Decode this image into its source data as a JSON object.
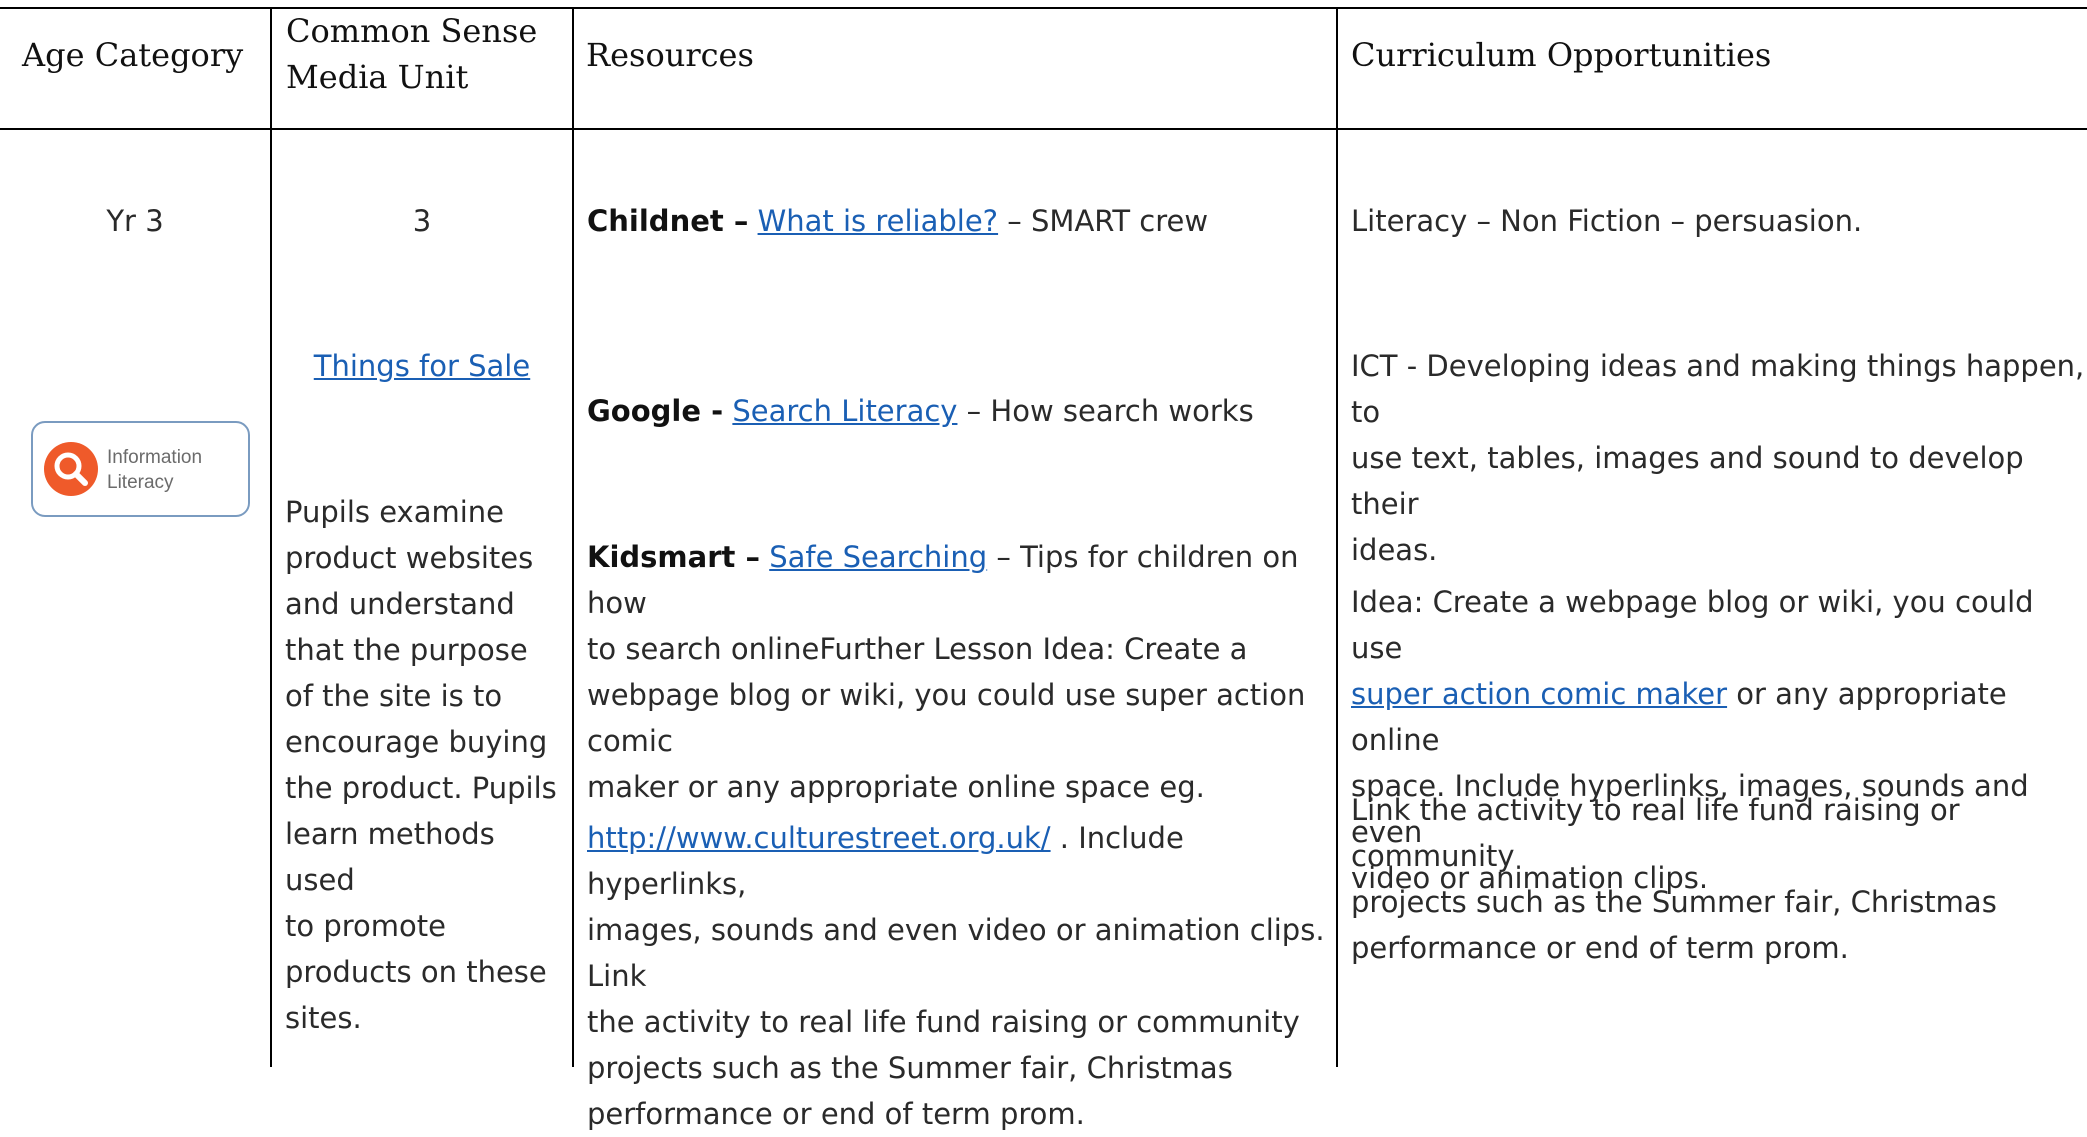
{
  "table": {
    "headers": {
      "age_category": "Age Category",
      "unit_line1": "Common Sense",
      "unit_line2": "Media Unit",
      "resources": "Resources",
      "curriculum": "Curriculum Opportunities"
    },
    "row": {
      "age": "Yr 3",
      "badge": {
        "line1": "Information",
        "line2": "Literacy",
        "icon": "magnifier-icon",
        "icon_color": "#ef5a2a"
      },
      "unit_number": "3",
      "unit_title": "Things for Sale",
      "unit_description": [
        "Pupils examine",
        "product websites",
        "and understand",
        "that the purpose",
        "of the site is to",
        "encourage buying",
        "the product. Pupils",
        "learn methods used",
        "to promote",
        "products on these",
        "sites."
      ],
      "resources": {
        "childnet": {
          "name": "Childnet –",
          "link": "What is reliable?",
          "rest": " – SMART crew"
        },
        "google": {
          "name": "Google -",
          "link": "Search Literacy",
          "rest": " – How search works"
        },
        "kidsmart": {
          "name": "Kidsmart –",
          "link": "Safe Searching",
          "rest_line1": " – Tips for children on how",
          "lines": [
            "to search onlineFurther Lesson Idea: Create a",
            "webpage blog or wiki, you could use super action comic",
            "maker  or any appropriate online space eg."
          ]
        },
        "culture_street": {
          "link": "http://www.culturestreet.org.uk/",
          "rest_line1": " . Include hyperlinks,",
          "lines": [
            "images, sounds and even video or animation clips. Link",
            "the activity to real life fund raising or community",
            "projects such as the Summer fair, Christmas",
            "performance or end of term prom."
          ]
        }
      },
      "curriculum": {
        "literacy": "Literacy  – Non Fiction – persuasion.",
        "ict_lines": [
          "ICT - Developing ideas and making things happen, to",
          "use text, tables, images and sound to develop their",
          "ideas."
        ],
        "idea_line1": "Idea: Create a webpage blog or wiki, you could use",
        "idea_link": "super action comic maker",
        "idea_link_rest": " or any appropriate online",
        "idea_lines": [
          "space. Include hyperlinks, images, sounds and even",
          "video or animation clips."
        ],
        "link_lines": [
          "Link the activity to real life fund raising or community",
          "projects such as the Summer fair, Christmas",
          "performance or end of term prom."
        ]
      }
    }
  }
}
